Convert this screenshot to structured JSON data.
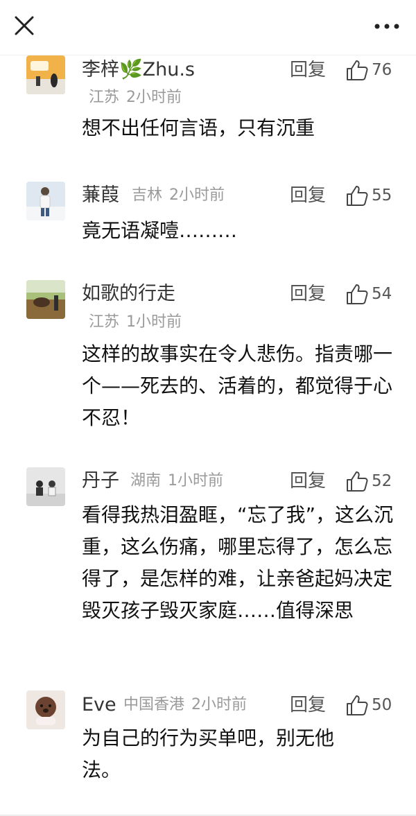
{
  "header": {
    "close_icon": "close-icon",
    "more_icon": "more-horizontal-icon"
  },
  "reply_label": "回复",
  "comments": [
    {
      "user": "李梓🌿Zhu.s",
      "region": "江苏",
      "time": "2小时前",
      "likes": "76",
      "text": "想不出任何言语，只有沉重"
    },
    {
      "user": "蒹葭",
      "region": "吉林",
      "time": "2小时前",
      "likes": "55",
      "text": "竟无语凝噎………"
    },
    {
      "user": "如歌的行走",
      "region": "江苏",
      "time": "1小时前",
      "likes": "54",
      "text": "这样的故事实在令人悲伤。指责哪一个——死去的、活着的，都觉得于心不忍！"
    },
    {
      "user": "丹子",
      "region": "湖南",
      "time": "1小时前",
      "likes": "52",
      "text": "看得我热泪盈眶，“忘了我”，这么沉重，这么伤痛，哪里忘得了，怎么忘得了，是怎样的难，让亲爸起妈决定毁灭孩子毁灭家庭……值得深思"
    },
    {
      "user": "Eve",
      "region": "中国香港",
      "time": "2小时前",
      "likes": "50",
      "text": "为自己的行为买单吧，别无他法。"
    }
  ]
}
